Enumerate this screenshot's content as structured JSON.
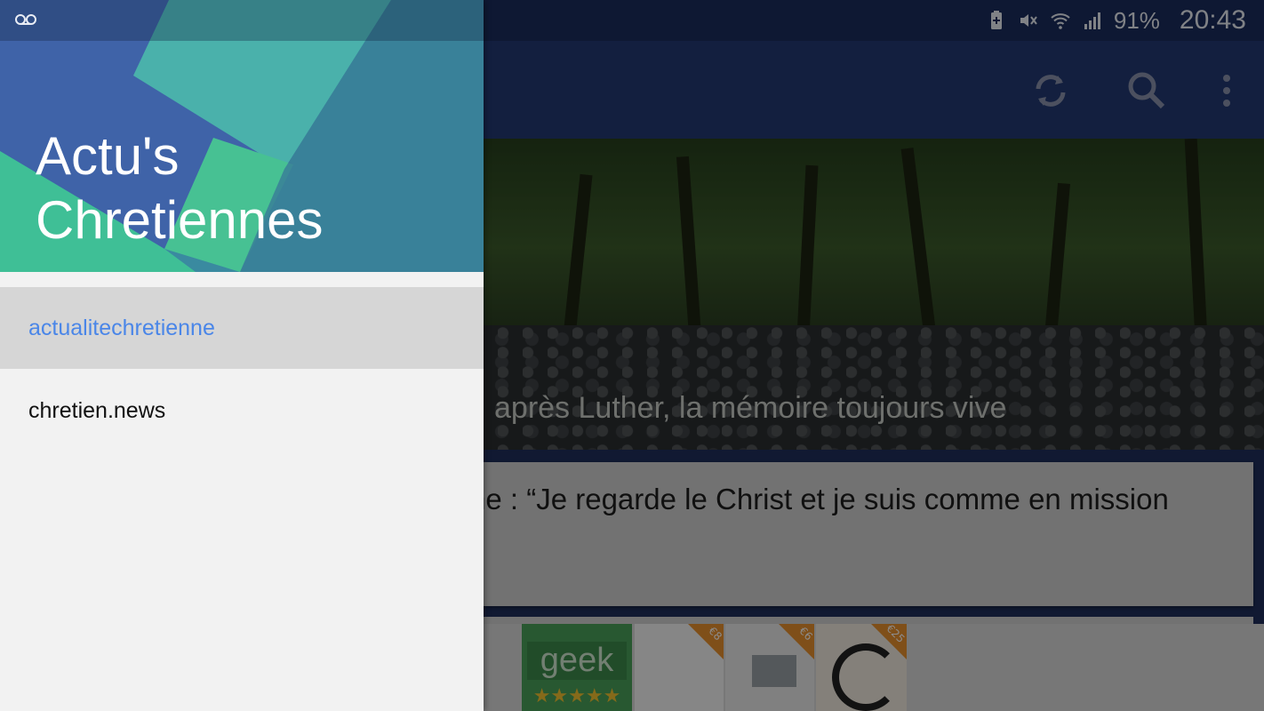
{
  "status_bar": {
    "battery": "91%",
    "time": "20:43",
    "icons": [
      "voicemail-icon",
      "battery-saver-icon",
      "mute-icon",
      "wifi-icon",
      "signal-icon"
    ]
  },
  "toolbar": {
    "actions": [
      "refresh-icon",
      "search-icon",
      "overflow-menu-icon"
    ]
  },
  "feed": {
    "featured_title": "après Luther, la mémoire toujours vive",
    "card_title": "ne : “Je regarde le Christ et je suis comme en mission",
    "ad": {
      "label": "geek",
      "price_tags": [
        "€8",
        "€6",
        "€25"
      ]
    }
  },
  "drawer": {
    "title": "Actu's Chretiennes",
    "items": [
      {
        "label": "actualitechretienne",
        "selected": true
      },
      {
        "label": "chretien.news",
        "selected": false
      }
    ]
  },
  "colors": {
    "status_bar": "#1b2d5e",
    "toolbar": "#233a73",
    "accent": "#4a86e8",
    "selected_bg": "#d6d6d6",
    "drawer_bg": "#f2f2f2"
  }
}
